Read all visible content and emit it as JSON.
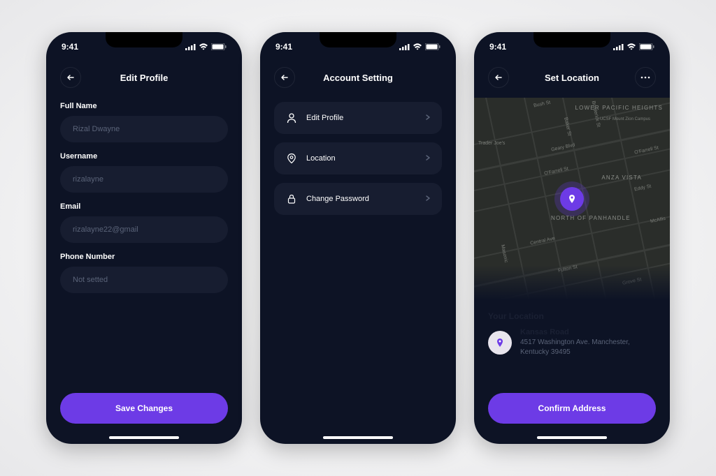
{
  "status": {
    "time": "9:41"
  },
  "screen1": {
    "title": "Edit Profile",
    "fields": {
      "fullname_label": "Full Name",
      "fullname_value": "Rizal Dwayne",
      "username_label": "Username",
      "username_value": "rizalayne",
      "email_label": "Email",
      "email_value": "rizalayne22@gmail",
      "phone_label": "Phone Number",
      "phone_value": "Not setted"
    },
    "save_button": "Save Changes"
  },
  "screen2": {
    "title": "Account Setting",
    "items": [
      {
        "label": "Edit Profile"
      },
      {
        "label": "Location"
      },
      {
        "label": "Change Password"
      }
    ]
  },
  "screen3": {
    "title": "Set Location",
    "section_heading": "Your Location",
    "location_name": "Kansas Road",
    "location_address": "4517 Washington Ave. Manchester, Kentucky 39495",
    "confirm_button": "Confirm Address",
    "map": {
      "areas": [
        "LOWER PACIFIC HEIGHTS",
        "ANZA VISTA",
        "NORTH OF PANHANDLE"
      ],
      "streets": [
        "Bush St",
        "Broderick St",
        "Baker St",
        "Geary Blvd",
        "O'Farrell St",
        "O'Farrell St",
        "Eddy St",
        "McAllis",
        "Central Ave",
        "Masonic",
        "Fulton St",
        "Grove St",
        "Trader Joe's",
        "UCSF Mount Zion Campus"
      ]
    }
  }
}
